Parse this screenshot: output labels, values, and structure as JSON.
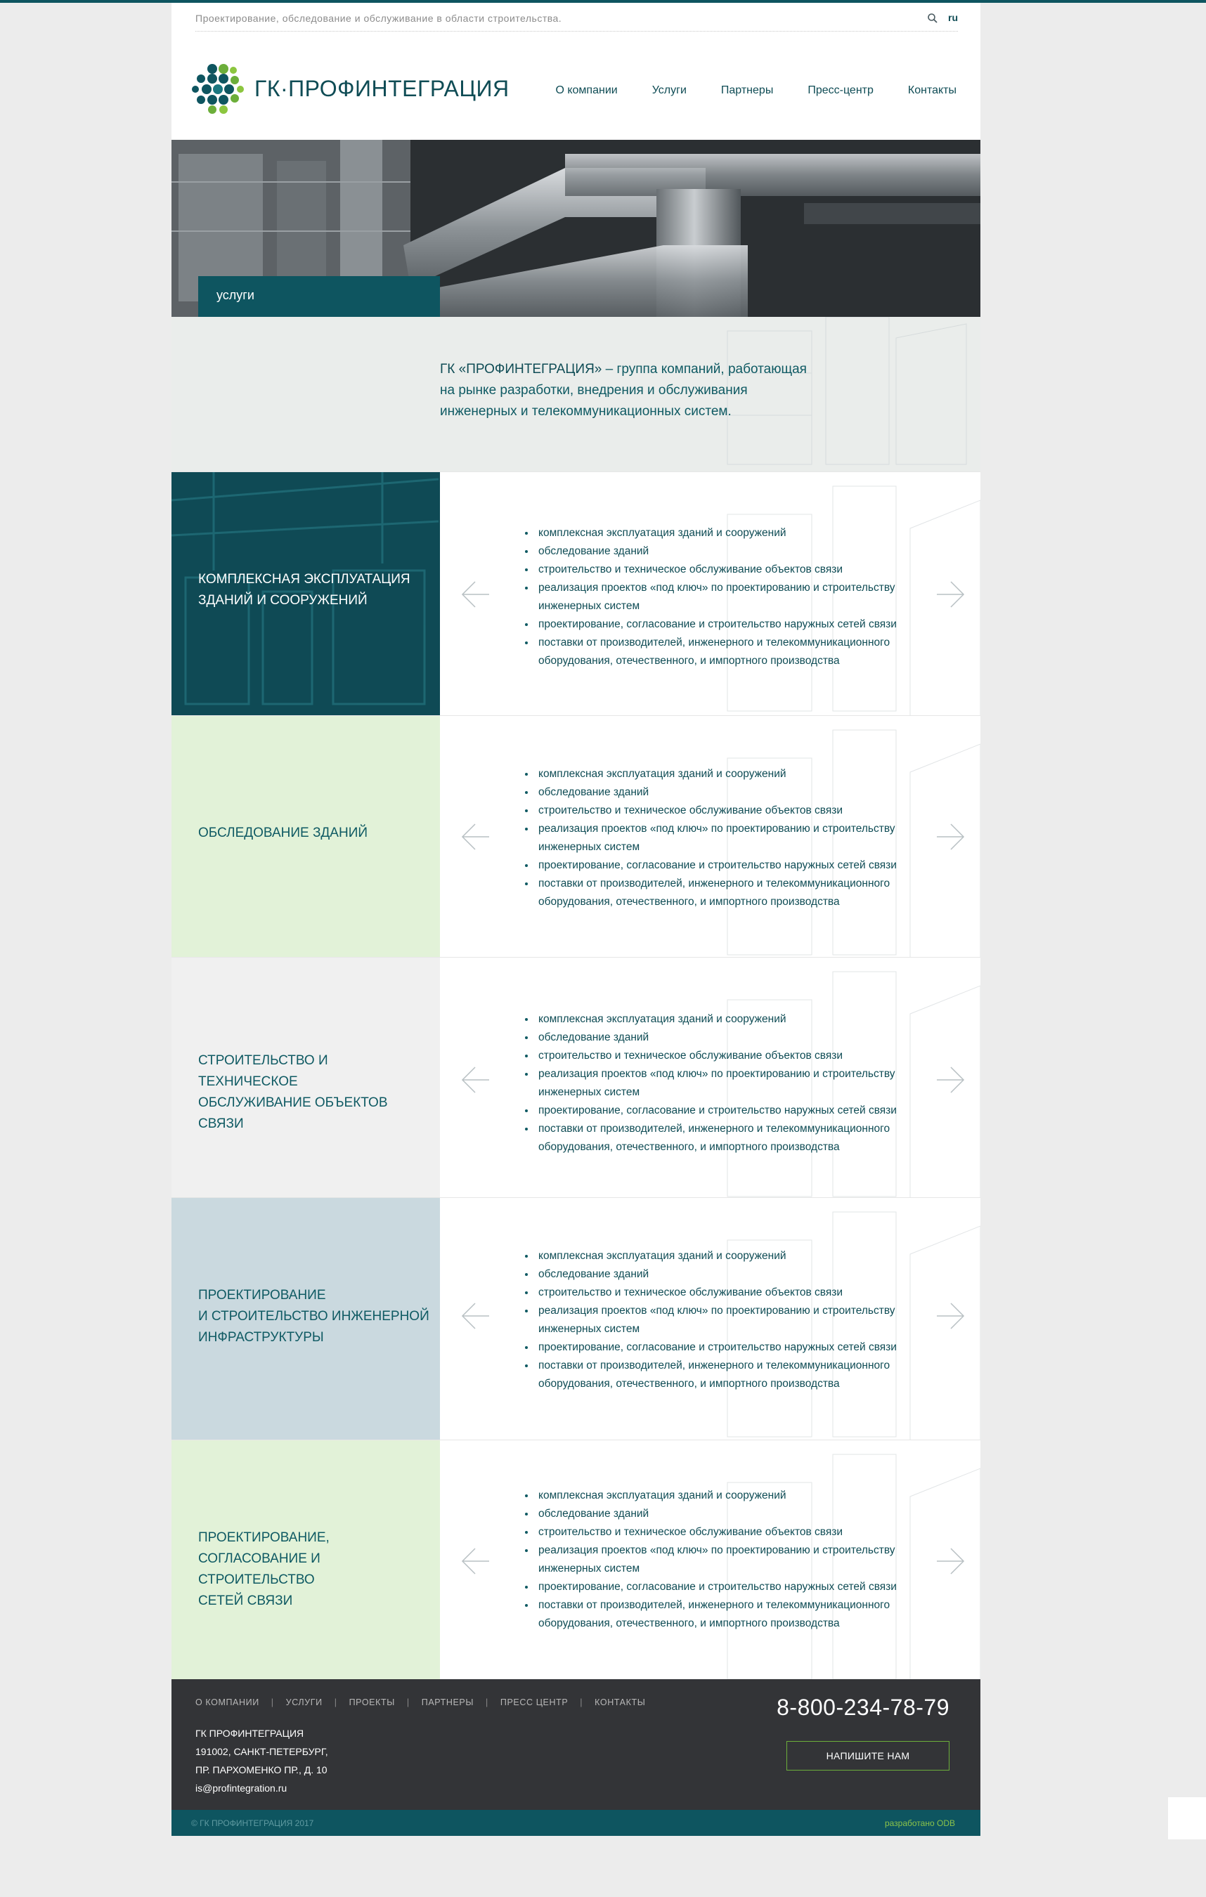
{
  "header": {
    "tagline": "Проектирование, обследование и обслуживание в области строительства.",
    "lang": "ru",
    "logo_text": "ГК·ПРОФИНТЕГРАЦИЯ",
    "nav": [
      "О компании",
      "Услуги",
      "Партнеры",
      "Пресс-центр",
      "Контакты"
    ]
  },
  "hero": {
    "tab_label": "услуги"
  },
  "intro": {
    "brand": "ГК «ПРОФИНТЕГРАЦИЯ»",
    "line1_rest": " – группа компаний, работающая",
    "line2": "на рынке разработки, внедрения и обслуживания",
    "line3": "инженерных и телекоммуникационных систем."
  },
  "services": [
    {
      "title_lines": [
        "КОМПЛЕКСНАЯ ЭКСПЛУАТАЦИЯ",
        "ЗДАНИЙ И СООРУЖЕНИЙ"
      ]
    },
    {
      "title_lines": [
        "ОБСЛЕДОВАНИЕ ЗДАНИЙ"
      ]
    },
    {
      "title_lines": [
        "СТРОИТЕЛЬСТВО И ТЕХНИЧЕСКОЕ",
        "ОБСЛУЖИВАНИЕ ОБЪЕКТОВ",
        "СВЯЗИ"
      ]
    },
    {
      "title_lines": [
        "ПРОЕКТИРОВАНИЕ",
        "И СТРОИТЕЛЬСТВО ИНЖЕНЕРНОЙ",
        "ИНФРАСТРУКТУРЫ"
      ]
    },
    {
      "title_lines": [
        "ПРОЕКТИРОВАНИЕ,",
        "СОГЛАСОВАНИЕ И СТРОИТЕЛЬСТВО",
        "СЕТЕЙ СВЯЗИ"
      ]
    }
  ],
  "service_items": [
    [
      "комплексная эксплуатация зданий и сооружений"
    ],
    [
      "обследование зданий"
    ],
    [
      "строительство и техническое обслуживание объектов связи"
    ],
    [
      "реализация проектов «под ключ» по проектированию и строительству",
      "инженерных систем"
    ],
    [
      "проектирование, согласование и строительство наружных сетей связи"
    ],
    [
      "поставки  от производителей, инженерного и телекоммуникационного",
      "оборудования, отечественного, и импортного производства"
    ]
  ],
  "footer": {
    "nav": [
      "О КОМПАНИИ",
      "УСЛУГИ",
      "ПРОЕКТЫ",
      "ПАРТНЕРЫ",
      "ПРЕСС ЦЕНТР",
      "КОНТАКТЫ"
    ],
    "address": [
      "ГК ПРОФИНТЕГРАЦИЯ",
      "191002, САНКТ-ПЕТЕРБУРГ,",
      "ПР. ПАРХОМЕНКО ПР., Д. 10",
      "is@profintegration.ru"
    ],
    "phone": "8-800-234-78-79",
    "button": "НАПИШИТЕ НАМ",
    "copyright": "© ГК ПРОФИНТЕГРАЦИЯ 2017",
    "developer": "разработано ODB"
  },
  "colors": {
    "teal": "#0e5560",
    "green": "#6cae3a",
    "panel_dark": "#0f4a55",
    "panel_green": "#e2f2d8",
    "panel_gray": "#f0f0f0",
    "panel_blue": "#cad9df"
  },
  "icons": [
    "search-icon",
    "arrow-left-icon",
    "arrow-right-icon"
  ]
}
